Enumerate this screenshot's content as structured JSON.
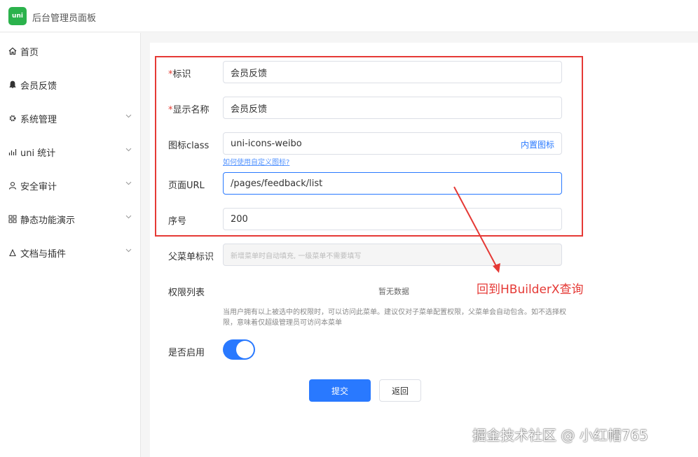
{
  "app": {
    "logo_text": "uni",
    "title": "后台管理员面板"
  },
  "sidebar": {
    "items": [
      {
        "label": "首页",
        "icon": "home-icon",
        "has_chevron": false
      },
      {
        "label": "会员反馈",
        "icon": "bell-icon",
        "has_chevron": false
      },
      {
        "label": "系统管理",
        "icon": "gear-icon",
        "has_chevron": true
      },
      {
        "label": "uni 统计",
        "icon": "chart-icon",
        "has_chevron": true
      },
      {
        "label": "安全审计",
        "icon": "user-icon",
        "has_chevron": true
      },
      {
        "label": "静态功能演示",
        "icon": "grid-icon",
        "has_chevron": true
      },
      {
        "label": "文档与插件",
        "icon": "doc-icon",
        "has_chevron": true
      }
    ]
  },
  "form": {
    "required_mark": "*",
    "id_label": "标识",
    "id_value": "会员反馈",
    "name_label": "显示名称",
    "name_value": "会员反馈",
    "icon_label": "图标class",
    "icon_value": "uni-icons-weibo",
    "icon_builtin_link": "内置图标",
    "icon_help_link": "如何使用自定义图标?",
    "url_label": "页面URL",
    "url_value": "/pages/feedback/list",
    "order_label": "序号",
    "order_value": "200",
    "parent_label": "父菜单标识",
    "parent_placeholder": "新增菜单时自动填充, 一级菜单不需要填写",
    "permission_label": "权限列表",
    "permission_empty": "暂无数据",
    "permission_hint": "当用户拥有以上被选中的权限时，可以访问此菜单。建议仅对子菜单配置权限，父菜单会自动包含。如不选择权限，意味着仅超级管理员可访问本菜单",
    "enable_label": "是否启用",
    "enable_value": true,
    "submit_label": "提交",
    "back_label": "返回"
  },
  "annotation": {
    "text": "回到HBuilderX查询",
    "color": "#e53935"
  },
  "watermark": "掘金技术社区 @ 小红帽765",
  "colors": {
    "primary": "#2979ff",
    "required": "#e43d33",
    "brand": "#2bb24c"
  }
}
